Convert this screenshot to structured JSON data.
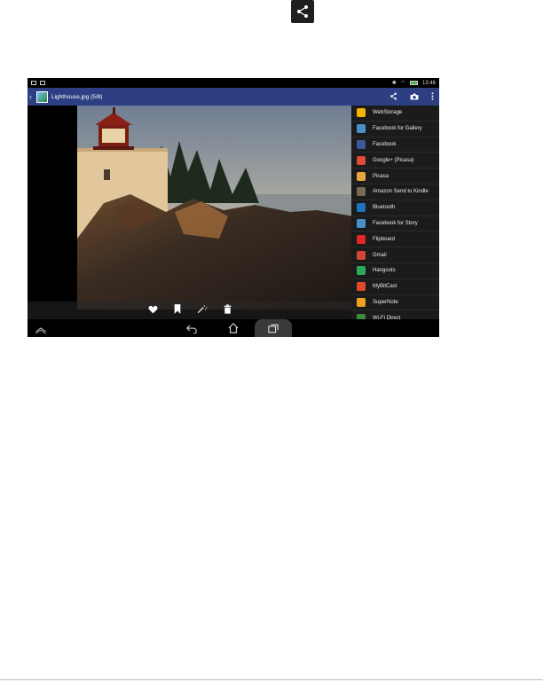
{
  "top_icon": {
    "icon": "share-icon"
  },
  "status_bar": {
    "time": "13:46"
  },
  "action_bar": {
    "title": "Lighthouse.jpg (5/8)",
    "icons": [
      "share-icon",
      "camera-icon",
      "overflow-menu-icon"
    ]
  },
  "photo": {
    "subject": "lighthouse-photo"
  },
  "bottom_actions": [
    "heart-icon",
    "bookmark-icon",
    "magic-wand-icon",
    "trash-icon"
  ],
  "share_menu": {
    "items": [
      {
        "label": "WebStorage",
        "color": "#f5b400"
      },
      {
        "label": "Facebook for Gallery",
        "color": "#4a90c8"
      },
      {
        "label": "Facebook",
        "color": "#3b5998"
      },
      {
        "label": "Google+ (Picasa)",
        "color": "#dd4b39"
      },
      {
        "label": "Picasa",
        "color": "#e8a33d"
      },
      {
        "label": "Amazon Send to Kindle",
        "color": "#7a6a55"
      },
      {
        "label": "Bluetooth",
        "color": "#1e73be"
      },
      {
        "label": "Facebook for Story",
        "color": "#4a90c8"
      },
      {
        "label": "Flipboard",
        "color": "#e12828"
      },
      {
        "label": "Gmail",
        "color": "#d44638"
      },
      {
        "label": "Hangouts",
        "color": "#2ea85a"
      },
      {
        "label": "MyBitCast",
        "color": "#e04a2a"
      },
      {
        "label": "SuperNote",
        "color": "#f0a020"
      },
      {
        "label": "Wi-Fi Direct",
        "color": "#3a8a3a"
      }
    ]
  },
  "nav_bar": {
    "icons": [
      "recent-up-icon",
      "back-icon",
      "home-icon",
      "recent-apps-icon"
    ]
  }
}
